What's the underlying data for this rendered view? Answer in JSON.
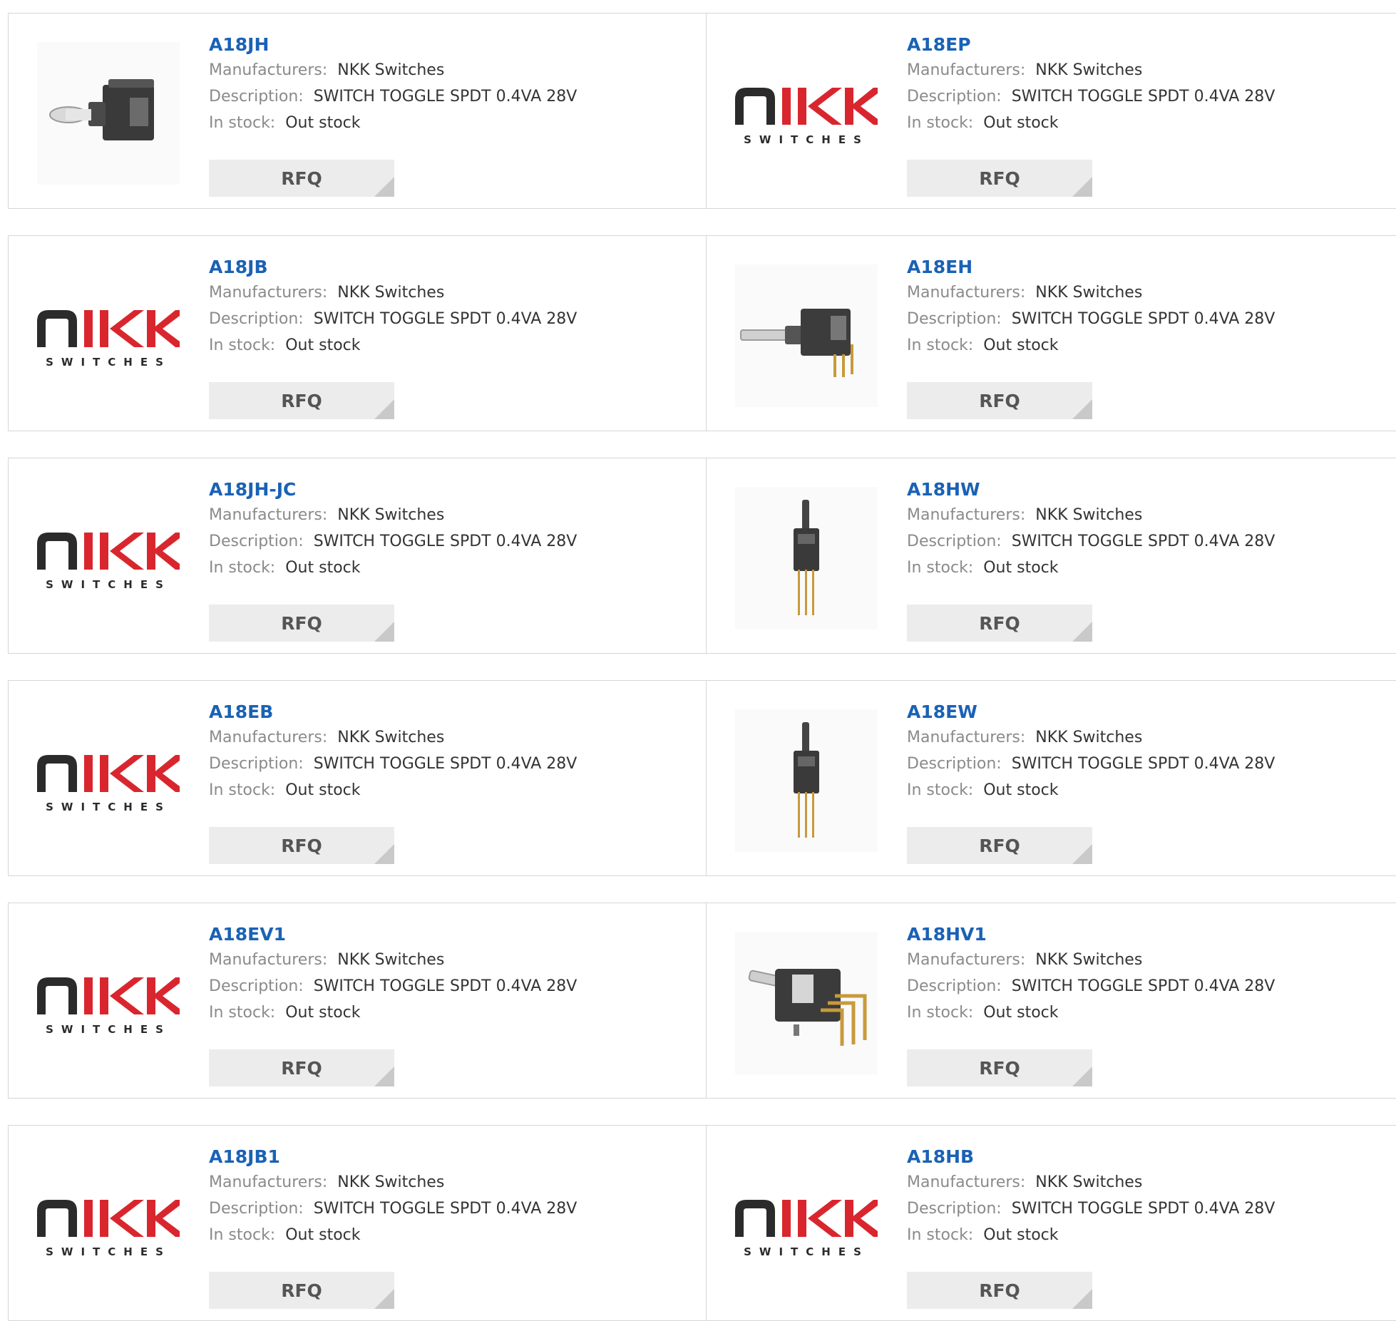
{
  "labels": {
    "manufacturers": "Manufacturers:",
    "description": "Description:",
    "in_stock": "In stock:",
    "rfq": "RFQ"
  },
  "logo_text": "SWITCHES",
  "colors": {
    "link": "#1a62b5",
    "logo_red": "#d9262e",
    "logo_dark": "#2b2b2b"
  },
  "products": [
    {
      "part": "A18JH",
      "manufacturer": "NKK Switches",
      "description": "SWITCH TOGGLE SPDT 0.4VA 28V",
      "stock": "Out stock",
      "image": "toggle-side-photo"
    },
    {
      "part": "A18EP",
      "manufacturer": "NKK Switches",
      "description": "SWITCH TOGGLE SPDT 0.4VA 28V",
      "stock": "Out stock",
      "image": "nkk-logo"
    },
    {
      "part": "A18JB",
      "manufacturer": "NKK Switches",
      "description": "SWITCH TOGGLE SPDT 0.4VA 28V",
      "stock": "Out stock",
      "image": "nkk-logo"
    },
    {
      "part": "A18EH",
      "manufacturer": "NKK Switches",
      "description": "SWITCH TOGGLE SPDT 0.4VA 28V",
      "stock": "Out stock",
      "image": "toggle-long-lever-photo"
    },
    {
      "part": "A18JH-JC",
      "manufacturer": "NKK Switches",
      "description": "SWITCH TOGGLE SPDT 0.4VA 28V",
      "stock": "Out stock",
      "image": "nkk-logo"
    },
    {
      "part": "A18HW",
      "manufacturer": "NKK Switches",
      "description": "SWITCH TOGGLE SPDT 0.4VA 28V",
      "stock": "Out stock",
      "image": "toggle-vertical-pins-photo"
    },
    {
      "part": "A18EB",
      "manufacturer": "NKK Switches",
      "description": "SWITCH TOGGLE SPDT 0.4VA 28V",
      "stock": "Out stock",
      "image": "nkk-logo"
    },
    {
      "part": "A18EW",
      "manufacturer": "NKK Switches",
      "description": "SWITCH TOGGLE SPDT 0.4VA 28V",
      "stock": "Out stock",
      "image": "toggle-vertical-pins-photo"
    },
    {
      "part": "A18EV1",
      "manufacturer": "NKK Switches",
      "description": "SWITCH TOGGLE SPDT 0.4VA 28V",
      "stock": "Out stock",
      "image": "nkk-logo"
    },
    {
      "part": "A18HV1",
      "manufacturer": "NKK Switches",
      "description": "SWITCH TOGGLE SPDT 0.4VA 28V",
      "stock": "Out stock",
      "image": "toggle-right-angle-photo"
    },
    {
      "part": "A18JB1",
      "manufacturer": "NKK Switches",
      "description": "SWITCH TOGGLE SPDT 0.4VA 28V",
      "stock": "Out stock",
      "image": "nkk-logo"
    },
    {
      "part": "A18HB",
      "manufacturer": "NKK Switches",
      "description": "SWITCH TOGGLE SPDT 0.4VA 28V",
      "stock": "Out stock",
      "image": "nkk-logo"
    }
  ]
}
